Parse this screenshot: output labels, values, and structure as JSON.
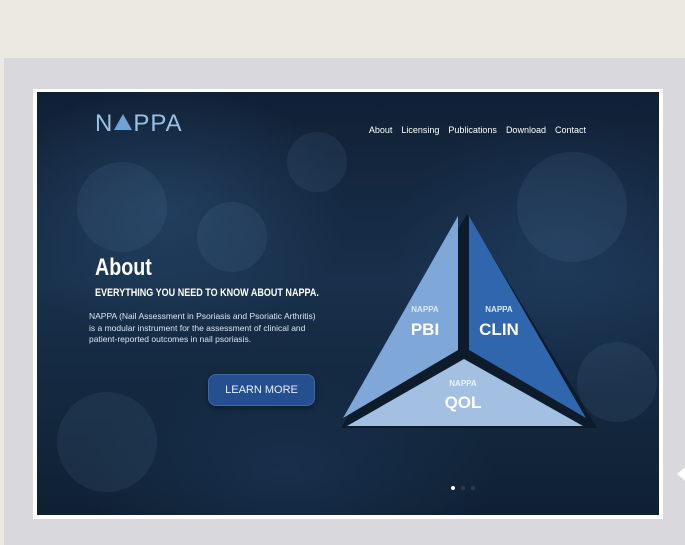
{
  "logo": {
    "prefix": "N",
    "suffix": "PPA"
  },
  "nav": {
    "items": [
      "About",
      "Licensing",
      "Publications",
      "Download",
      "Contact"
    ]
  },
  "hero": {
    "title": "About",
    "subtitle": "EVERYTHING YOU NEED TO KNOW ABOUT NAPPA.",
    "description": "NAPPA (Nail Assessment in Psoriasis and Psoriatic Arthritis) is a modular instrument for the assessment of clinical and patient-reported outcomes in nail psoriasis.",
    "button_label": "LEARN MORE"
  },
  "pyramid": {
    "pbi": {
      "top": "NAPPA",
      "bottom": "PBI"
    },
    "clin": {
      "top": "NAPPA",
      "bottom": "CLIN"
    },
    "qol": {
      "top": "NAPPA",
      "bottom": "QOL"
    }
  },
  "carousel": {
    "slide_count": 3,
    "active_index": 0
  },
  "colors": {
    "accent": "#264f8f",
    "pyramid_light": "#7fa8d8",
    "pyramid_dark": "#2f66ad"
  }
}
